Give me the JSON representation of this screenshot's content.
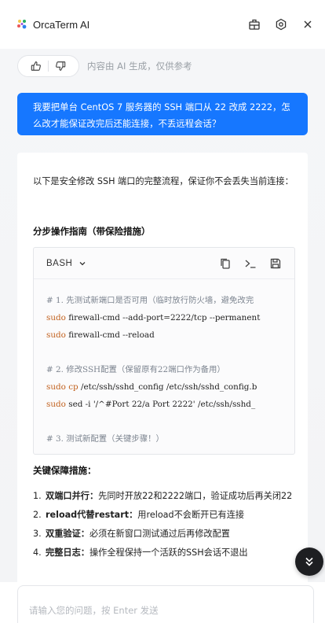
{
  "app": {
    "title": "OrcaTerm AI",
    "icons": [
      "orca-logo-icon",
      "panel-icon",
      "settings-icon",
      "close-icon"
    ]
  },
  "feedback": {
    "note": "内容由 AI 生成，仅供参考",
    "icons": [
      "thumbs-up-icon",
      "thumbs-down-icon"
    ]
  },
  "user_message": "我要把单台 CentOS 7 服务器的 SSH 端口从 22 改成 2222，怎么改才能保证改完后还能连接，不丢远程会话？",
  "answer": {
    "intro": "以下是安全修改 SSH 端口的完整流程，保证你不会丢失当前连接：",
    "guide_heading": "分步操作指南（带保险措施）",
    "code": {
      "language": "BASH",
      "actions": [
        "copy-icon",
        "terminal-icon",
        "save-icon"
      ],
      "lines": [
        {
          "type": "comment",
          "text": "# 1. 先测试新端口是否可用（临时放行防火墙，避免改完"
        },
        {
          "type": "cmd",
          "kw": "sudo",
          "text": " firewall-cmd --add-port=2222/tcp --permanent"
        },
        {
          "type": "cmd",
          "kw": "sudo",
          "text": " firewall-cmd --reload"
        },
        {
          "type": "blank",
          "text": ""
        },
        {
          "type": "comment",
          "text": "# 2. 修改SSH配置（保留原有22端口作为备用）"
        },
        {
          "type": "cmd",
          "kw": "sudo cp",
          "text": " /etc/ssh/sshd_config /etc/ssh/sshd_config.b"
        },
        {
          "type": "cmd",
          "kw": "sudo",
          "text": " sed -i '/^#Port 22/a Port 2222' /etc/ssh/sshd_"
        },
        {
          "type": "blank",
          "text": ""
        },
        {
          "type": "comment",
          "text": "# 3. 测试新配置（关键步骤！）"
        }
      ]
    },
    "measures_heading": "关键保障措施：",
    "measures": [
      {
        "num": "1.",
        "bold": "双端口并行：",
        "text": "先同时开放22和2222端口，验证成功后再关闭22"
      },
      {
        "num": "2.",
        "bold": "reload代替restart：",
        "text": "用reload不会断开已有连接"
      },
      {
        "num": "3.",
        "bold": "双重验证：",
        "text": "必须在新窗口测试通过后再修改配置"
      },
      {
        "num": "4.",
        "bold": "完整日志：",
        "text": "操作全程保持一个活跃的SSH会话不退出"
      }
    ]
  },
  "input": {
    "placeholder": "请输入您的问题，按 Enter 发送"
  },
  "colors": {
    "accent": "#1677ff",
    "background": "#f5f6f8",
    "code_keyword": "#c2611e",
    "code_comment": "#7d8590"
  }
}
